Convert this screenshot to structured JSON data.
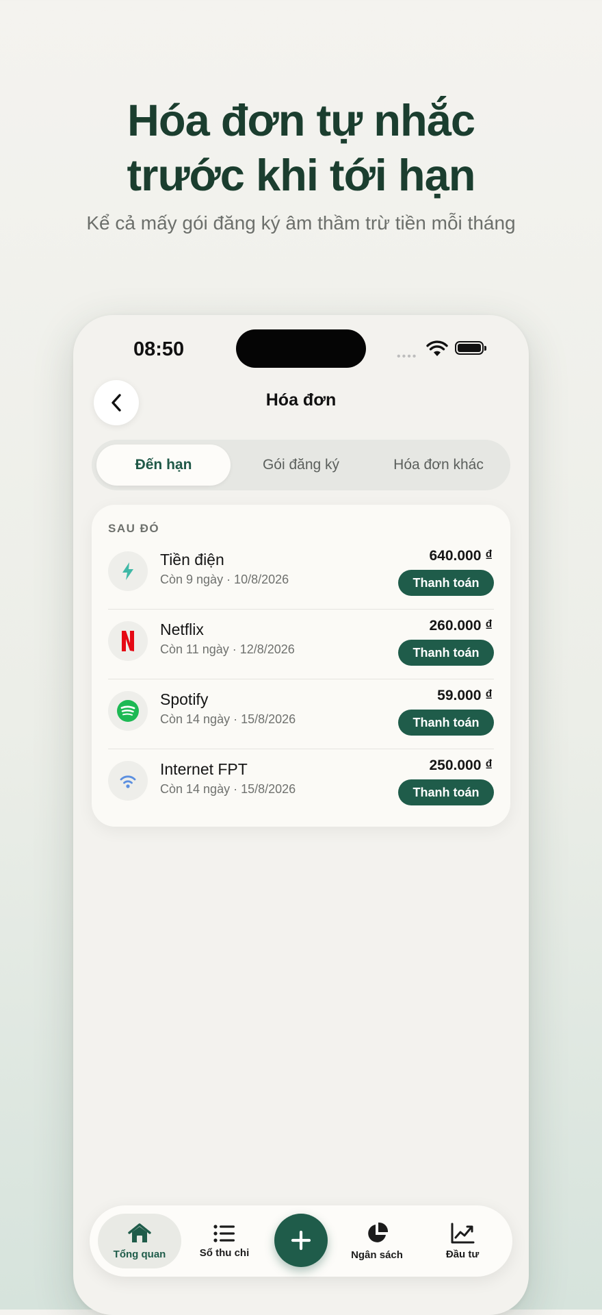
{
  "hero": {
    "title_line1": "Hóa đơn tự nhắc",
    "title_line2": "trước khi tới hạn",
    "subtitle": "Kể cả mấy gói đăng ký âm thầm trừ tiền mỗi tháng"
  },
  "status_bar": {
    "time": "08:50",
    "signal": "••••"
  },
  "header": {
    "title": "Hóa đơn",
    "back_icon": "chevron-left-icon"
  },
  "segments": [
    {
      "label": "Đến hạn",
      "active": true
    },
    {
      "label": "Gói đăng ký",
      "active": false
    },
    {
      "label": "Hóa đơn khác",
      "active": false
    }
  ],
  "bills_section": {
    "label": "SAU ĐÓ",
    "items": [
      {
        "name": "Tiền điện",
        "meta": "Còn 9 ngày · 10/8/2026",
        "amount": "640.000 ₫",
        "pay_label": "Thanh toán",
        "icon": "lightning-icon"
      },
      {
        "name": "Netflix",
        "meta": "Còn 11 ngày · 12/8/2026",
        "amount": "260.000 ₫",
        "pay_label": "Thanh toán",
        "icon": "netflix-icon"
      },
      {
        "name": "Spotify",
        "meta": "Còn 14 ngày · 15/8/2026",
        "amount": "59.000 ₫",
        "pay_label": "Thanh toán",
        "icon": "spotify-icon"
      },
      {
        "name": "Internet FPT",
        "meta": "Còn 14 ngày · 15/8/2026",
        "amount": "250.000 ₫",
        "pay_label": "Thanh toán",
        "icon": "wifi-icon"
      }
    ]
  },
  "tabbar": {
    "items": [
      {
        "label": "Tổng quan",
        "icon": "home-icon",
        "active": true
      },
      {
        "label": "Sổ thu chi",
        "icon": "list-icon",
        "active": false
      },
      {
        "label": "Ngân sách",
        "icon": "pie-chart-icon",
        "active": false
      },
      {
        "label": "Đầu tư",
        "icon": "trend-chart-icon",
        "active": false
      }
    ],
    "fab_icon": "plus-icon"
  },
  "colors": {
    "accent": "#1f5c4a",
    "title": "#1b3e2f",
    "netflix": "#e50914",
    "spotify": "#1db954",
    "electric": "#3fb8a6",
    "wifi": "#5b8fe0"
  }
}
